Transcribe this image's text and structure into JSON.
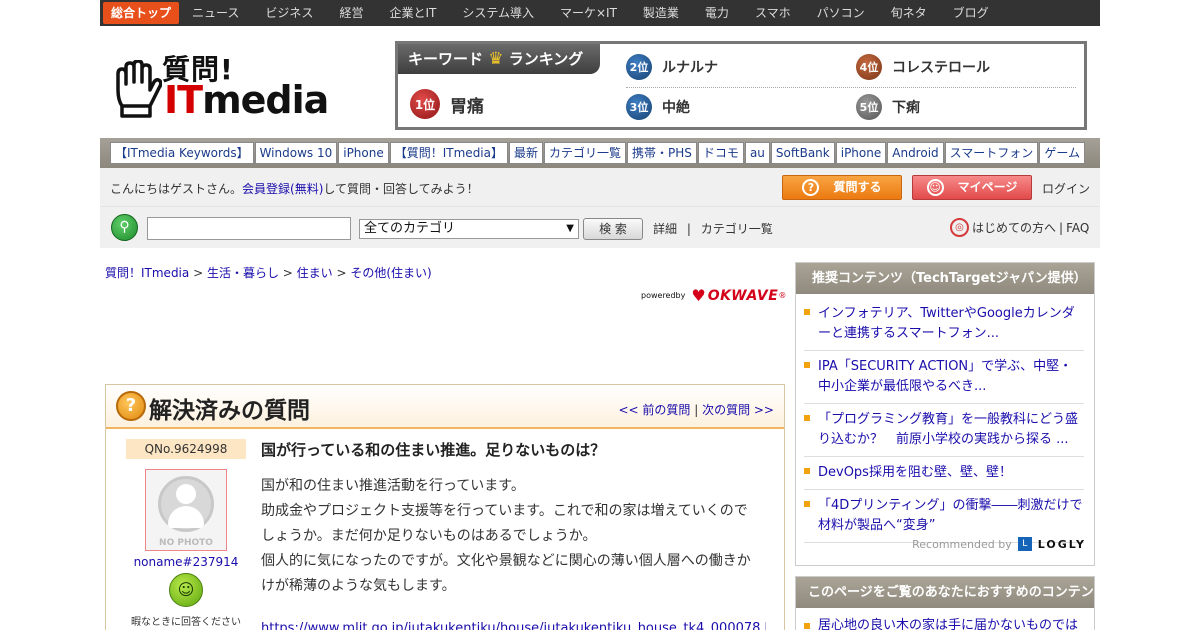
{
  "topnav": {
    "items": [
      "総合トップ",
      "ニュース",
      "ビジネス",
      "経営",
      "企業とIT",
      "システム導入",
      "マーケ×IT",
      "製造業",
      "電力",
      "スマホ",
      "パソコン",
      "旬ネタ",
      "ブログ"
    ]
  },
  "logo": {
    "line1": "質問!",
    "it": "IT",
    "media": "media"
  },
  "ranking": {
    "title": "キーワード",
    "title2": "ランキング",
    "crown": "♛",
    "items": [
      {
        "rank": "1位",
        "word": "胃痛"
      },
      {
        "rank": "2位",
        "word": "ルナルナ"
      },
      {
        "rank": "3位",
        "word": "中絶"
      },
      {
        "rank": "4位",
        "word": "コレステロール"
      },
      {
        "rank": "5位",
        "word": "下痢"
      }
    ]
  },
  "keywords": [
    "【ITmedia Keywords】",
    "Windows 10",
    "iPhone",
    "【質問！ITmedia】",
    "最新",
    "カテゴリ一覧",
    "携帯・PHS",
    "ドコモ",
    "au",
    "SoftBank",
    "iPhone",
    "Android",
    "スマートフォン",
    "ゲーム"
  ],
  "welcome": {
    "pre": "こんにちはゲストさん。",
    "link": "会員登録(無料)",
    "post": "して質問・回答してみよう！",
    "ask_button": "質問する",
    "mypage_button": "マイページ",
    "login": "ログイン"
  },
  "search": {
    "input_value": "",
    "category": "全てのカテゴリ",
    "button": "検 索",
    "detail": "詳細",
    "divider": "|",
    "category_list": "カテゴリ一覧",
    "first_time": "はじめての方へ",
    "pipe": "|",
    "faq": "FAQ"
  },
  "breadcrumb": {
    "items": [
      "質問！ITmedia",
      "生活・暮らし",
      "住まい",
      "その他(住まい)"
    ],
    "separator": " > "
  },
  "powered": {
    "prefix": "poweredby",
    "brand": "OKWAVE",
    "mark": "®"
  },
  "question": {
    "header": "解決済みの質問",
    "prev": "<< 前の質問",
    "nav_sep": " | ",
    "next": "次の質問 >>",
    "qno": "QNo.9624998",
    "photo_label": "NO PHOTO",
    "username": "noname#237914",
    "hint": "暇なときに回答ください",
    "title": "国が行っている和の住まい推進。足りないものは？",
    "body_lines": [
      "国が和の住まい推進活動を行っています。",
      "助成金やプロジェクト支援等を行っています。これで和の家は増えていくので",
      "しょうか。まだ何か足りないものはあるでしょうか。",
      "個人的に気になったのですが。文化や景観などに関心の薄い個人層への働きか",
      "けが稀薄のような気もします。"
    ],
    "url": "https://www.mlit.go.jp/jutakukentiku/house/jutakukentiku_house_tk4_000078.html"
  },
  "sidebar": {
    "title": "推奨コンテンツ（TechTargetジャパン提供）",
    "items": [
      "インフォテリア、TwitterやGoogleカレンダーと連携するスマートフォン...",
      "IPA「SECURITY ACTION」で学ぶ、中堅・中小企業が最低限やるべき...",
      "「プログラミング教育」を一般教科にどう盛り込むか？　前原小学校の実践から探る ...",
      "DevOps採用を阻む壁、壁、壁！",
      "「4Dプリンティング」の衝撃――刺激だけで材料が製品へ“変身”"
    ],
    "recommended": "Recommended by",
    "logly": "LOGLY"
  },
  "sidebar2": {
    "title": "このページをご覧のあなたにおすすめのコンテンツ",
    "items": [
      "居心地の良い木の家は手に届かないものでは"
    ]
  }
}
